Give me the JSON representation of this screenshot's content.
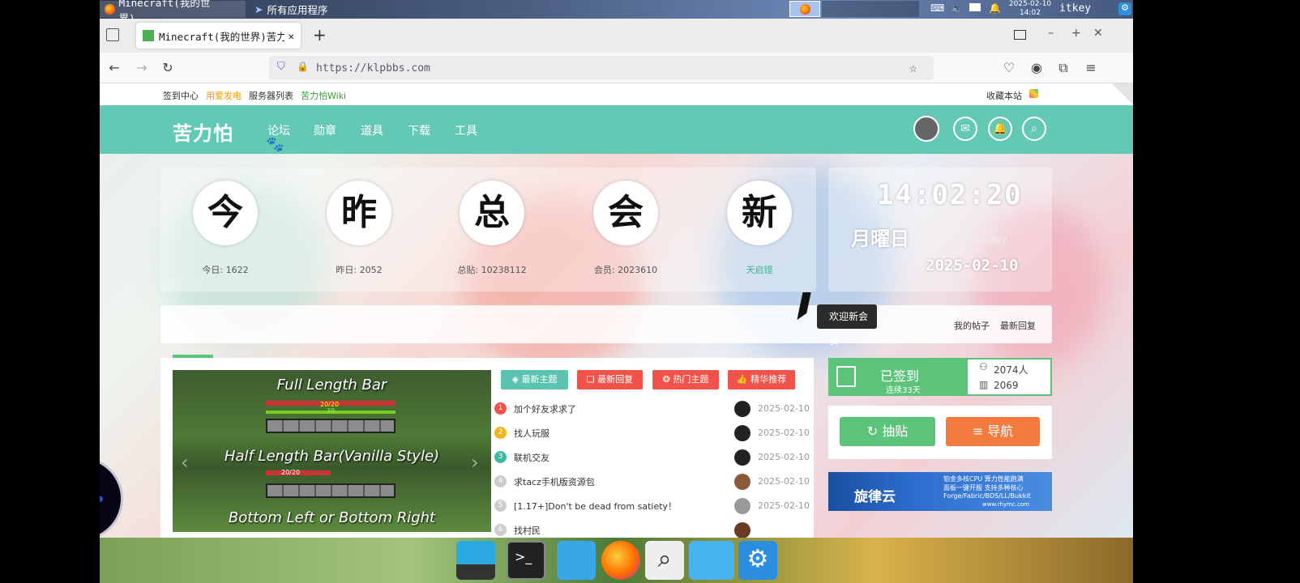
{
  "system_panel": {
    "task1": "Minecraft(我的世界)...",
    "task2": "所有应用程序",
    "date": "2025-02-10",
    "time": "14:02",
    "user": "itkey"
  },
  "browser": {
    "tab_title": "Minecraft(我的世界)苦力",
    "url": "https://klpbbs.com"
  },
  "top_links": {
    "sign": "签到中心",
    "power": "用爱发电",
    "servers": "服务器列表",
    "wiki": "苦力怕Wiki",
    "favorite": "收藏本站"
  },
  "nav": {
    "logo": "苦力怕",
    "items": [
      "论坛",
      "勋章",
      "道具",
      "下载",
      "工具"
    ]
  },
  "stats": [
    {
      "glyph": "今",
      "label": "今日: 1622"
    },
    {
      "glyph": "昨",
      "label": "昨日: 2052"
    },
    {
      "glyph": "总",
      "label": "总贴: 10238112"
    },
    {
      "glyph": "会",
      "label": "会员: 2023610"
    },
    {
      "glyph": "新",
      "label": "天启铿"
    }
  ],
  "clock": {
    "time": "14:02:20",
    "weekday_jp": "月曜日",
    "weekday_cn": "(一)",
    "weekday_en": "Monday",
    "date": "2025-02-10"
  },
  "strip": {
    "tooltip": "欢迎新会员",
    "my_posts": "我的帖子",
    "latest_replies": "最新回复"
  },
  "slides": [
    "Full Length Bar",
    "Half Length Bar(Vanilla Style)",
    "Bottom Left or Bottom Right"
  ],
  "hud_values": {
    "hp1": "20/20",
    "xp1": "39",
    "hp2": "20/20"
  },
  "thread_tabs": [
    "最新主题",
    "最新回复",
    "热门主题",
    "精华推荐"
  ],
  "threads": [
    {
      "n": "1",
      "title": "加个好友求求了",
      "date": "2025-02-10"
    },
    {
      "n": "2",
      "title": "找人玩服",
      "date": "2025-02-10"
    },
    {
      "n": "3",
      "title": "联机交友",
      "date": "2025-02-10"
    },
    {
      "n": "4",
      "title": "求tacz手机版资源包",
      "date": "2025-02-10"
    },
    {
      "n": "5",
      "title": "[1.17+]Don't be dead from satiety！",
      "date": "2025-02-10"
    },
    {
      "n": "6",
      "title": "找村民",
      "date": ""
    }
  ],
  "signin": {
    "status": "已签到",
    "streak": "连续33天",
    "count1": "2074人",
    "count2": "2069"
  },
  "buttons": {
    "draw": "抽贴",
    "guide": "导航"
  },
  "banner": {
    "brand": "旋律云",
    "line1": "铂金多核CPU 算力性能跑满",
    "line2": "面板一键开服 支持多种核心",
    "line3": "Forge/Fabric/BDS/LL/Bukkit",
    "url": "www.rhymc.com"
  },
  "colors": {
    "nav_bg": "#63c9b5",
    "signin_green": "#5cc37a",
    "tab_red": "#f0534a",
    "tab_teal": "#5bc4b0",
    "guide_orange": "#f47a3e"
  }
}
